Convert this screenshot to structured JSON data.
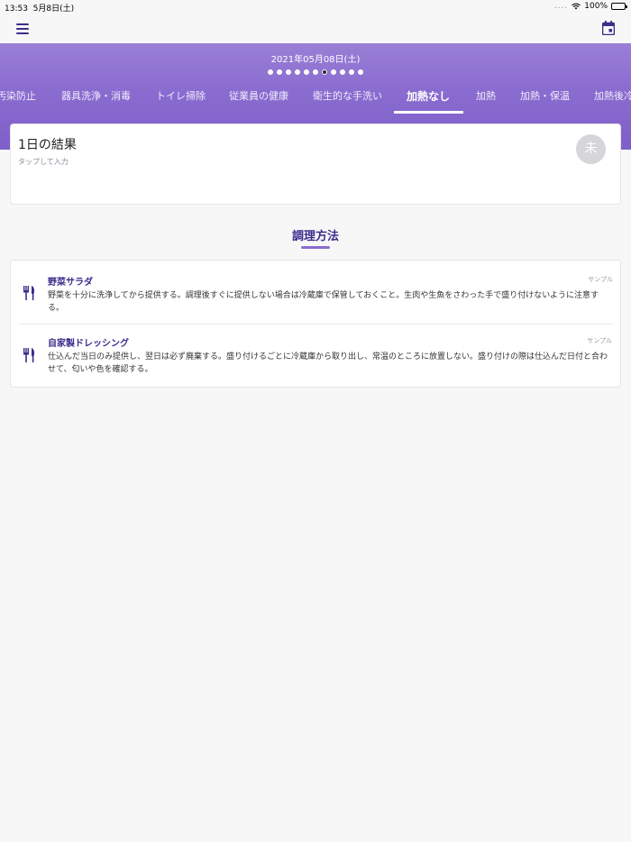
{
  "status_bar": {
    "time": "13:53",
    "date": "5月8日(土)",
    "signal_dots": "....",
    "battery": "100%"
  },
  "header": {
    "date": "2021年05月08日(土)",
    "page_count": 11,
    "active_page": 7,
    "tabs": [
      {
        "label": "汚染防止"
      },
      {
        "label": "器具洗浄・消毒"
      },
      {
        "label": "トイレ掃除"
      },
      {
        "label": "従業員の健康"
      },
      {
        "label": "衛生的な手洗い"
      },
      {
        "label": "加熱なし",
        "active": true
      },
      {
        "label": "加熱"
      },
      {
        "label": "加熱・保温"
      },
      {
        "label": "加熱後冷"
      }
    ]
  },
  "result": {
    "title": "1日の結果",
    "hint": "タップして入力",
    "status": "未"
  },
  "section": {
    "title": "調理方法"
  },
  "methods": [
    {
      "icon": "utensils-icon",
      "name": "野菜サラダ",
      "tag": "サンプル",
      "description": "野菜を十分に洗浄してから提供する。調理後すぐに提供しない場合は冷蔵庫で保管しておくこと。生肉や生魚をさわった手で盛り付けないように注意する。"
    },
    {
      "icon": "utensils-icon",
      "name": "自家製ドレッシング",
      "tag": "サンプル",
      "description": "仕込んだ当日のみ提供し、翌日は必ず廃棄する。盛り付けるごとに冷蔵庫から取り出し、常温のところに放置しない。盛り付けの際は仕込んだ日付と合わせて、匂いや色を確認する。"
    }
  ],
  "colors": {
    "accent": "#8a6cd0",
    "title": "#3c2c8c"
  }
}
